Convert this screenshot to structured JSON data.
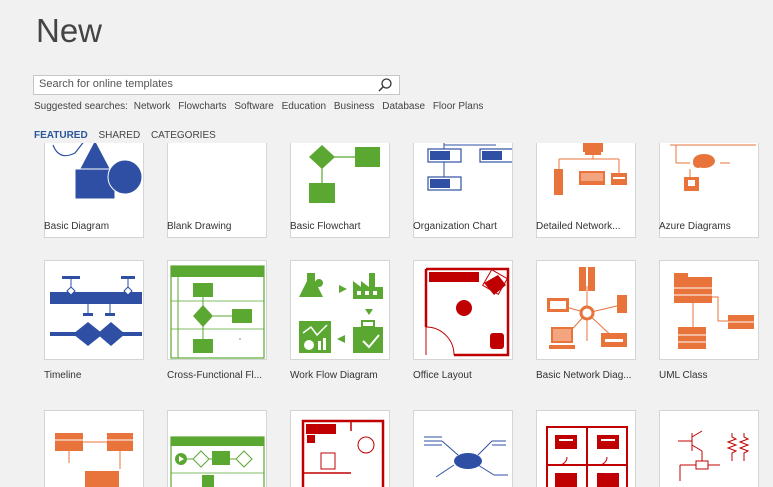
{
  "page": {
    "title": "New"
  },
  "search": {
    "placeholder": "Search for online templates"
  },
  "suggested": {
    "label": "Suggested searches:",
    "items": [
      "Network",
      "Flowcharts",
      "Software",
      "Education",
      "Business",
      "Database",
      "Floor Plans"
    ]
  },
  "tabs": [
    {
      "label": "FEATURED",
      "active": true
    },
    {
      "label": "SHARED",
      "active": false
    },
    {
      "label": "CATEGORIES",
      "active": false
    }
  ],
  "templates": [
    {
      "label": "Basic Diagram"
    },
    {
      "label": "Blank Drawing"
    },
    {
      "label": "Basic Flowchart"
    },
    {
      "label": "Organization Chart"
    },
    {
      "label": "Detailed Network..."
    },
    {
      "label": "Azure Diagrams"
    },
    {
      "label": "Timeline"
    },
    {
      "label": "Cross-Functional Fl..."
    },
    {
      "label": "Work Flow Diagram"
    },
    {
      "label": "Office Layout"
    },
    {
      "label": "Basic Network Diag..."
    },
    {
      "label": "UML Class"
    },
    {
      "label": ""
    },
    {
      "label": ""
    },
    {
      "label": ""
    },
    {
      "label": ""
    },
    {
      "label": ""
    },
    {
      "label": ""
    }
  ],
  "colors": {
    "accent": "#2b579a",
    "blue": "#2e4fa3",
    "green": "#5aa832",
    "orange": "#e8743b",
    "red": "#c00000"
  }
}
